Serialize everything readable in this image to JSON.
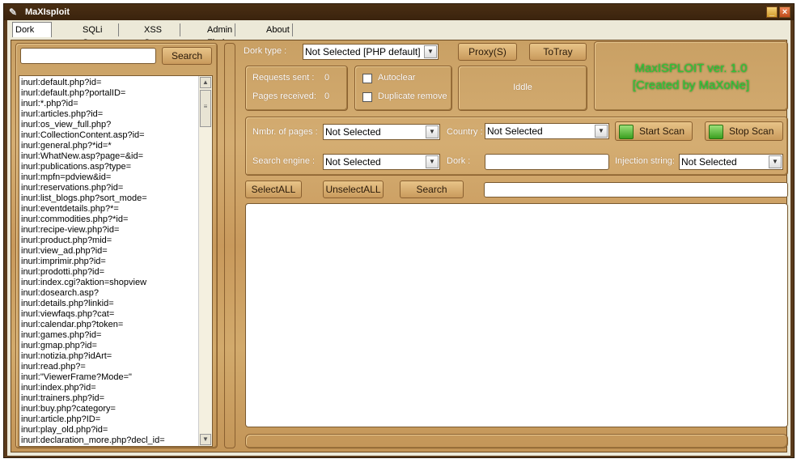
{
  "window": {
    "title": "MaXIsploit"
  },
  "tabs": [
    "Dork Scanner",
    "SQLi Scanner",
    "XSS Scanner",
    "Admin Finder",
    "About"
  ],
  "left": {
    "search_value": "",
    "search_button": "Search",
    "dorks": [
      "inurl:default.php?id=",
      "inurl:default.php?portalID=",
      "inurl:*.php?id=",
      "inurl:articles.php?id=",
      "inurl:os_view_full.php?",
      "inurl:CollectionContent.asp?id=",
      "inurl:general.php?*id=*",
      "inurl:WhatNew.asp?page=&id=",
      "inurl:publications.asp?type=",
      "inurl:mpfn=pdview&id=",
      "inurl:reservations.php?id=",
      "inurl:list_blogs.php?sort_mode=",
      "inurl:eventdetails.php?*=",
      "inurl:commodities.php?*id=",
      "inurl:recipe-view.php?id=",
      "inurl:product.php?mid=",
      "inurl:view_ad.php?id=",
      "inurl:imprimir.php?id=",
      "inurl:prodotti.php?id=",
      "inurl:index.cgi?aktion=shopview",
      "inurl:dosearch.asp?",
      "inurl:details.php?linkid=",
      "inurl:viewfaqs.php?cat=",
      "inurl:calendar.php?token=",
      "inurl:games.php?id=",
      "inurl:gmap.php?id=",
      "inurl:notizia.php?idArt=",
      "inurl:read.php?=",
      "inurl:\"ViewerFrame?Mode=\"",
      "inurl:index.php?id=",
      "inurl:trainers.php?id=",
      "inurl:buy.php?category=",
      "inurl:article.php?ID=",
      "inurl:play_old.php?id=",
      "inurl:declaration_more.php?decl_id="
    ]
  },
  "top": {
    "dork_type_label": "Dork type :",
    "dork_type_value": "Not Selected [PHP default]",
    "proxy_button": "Proxy(S)",
    "totray_button": "ToTray",
    "brand_line1": "MaxISPLOIT ver. 1.0",
    "brand_line2": "[Created by MaXoNe]"
  },
  "stats": {
    "requests_label": "Requests sent :",
    "requests_value": "0",
    "pages_label": "Pages received:",
    "pages_value": "0",
    "autoclear_label": "Autoclear",
    "duplicate_label": "Duplicate remove",
    "status_text": "Iddle"
  },
  "config": {
    "pages_label": "Nmbr. of pages :",
    "pages_value": "Not Selected",
    "country_label": "Country :",
    "country_value": "Not Selected",
    "start_button": "Start Scan",
    "stop_button": "Stop Scan",
    "engine_label": "Search engine :",
    "engine_value": "Not Selected",
    "dork_label": "Dork :",
    "dork_value": "",
    "injection_label": "Injection string:",
    "injection_value": "Not Selected"
  },
  "actions": {
    "select_all": "SelectALL",
    "unselect_all": "UnselectALL",
    "search": "Search",
    "search_field_value": ""
  },
  "colors": {
    "wood": "#cfa66a",
    "brand_green": "#2ec83a",
    "title_bar": "#3a230d"
  }
}
